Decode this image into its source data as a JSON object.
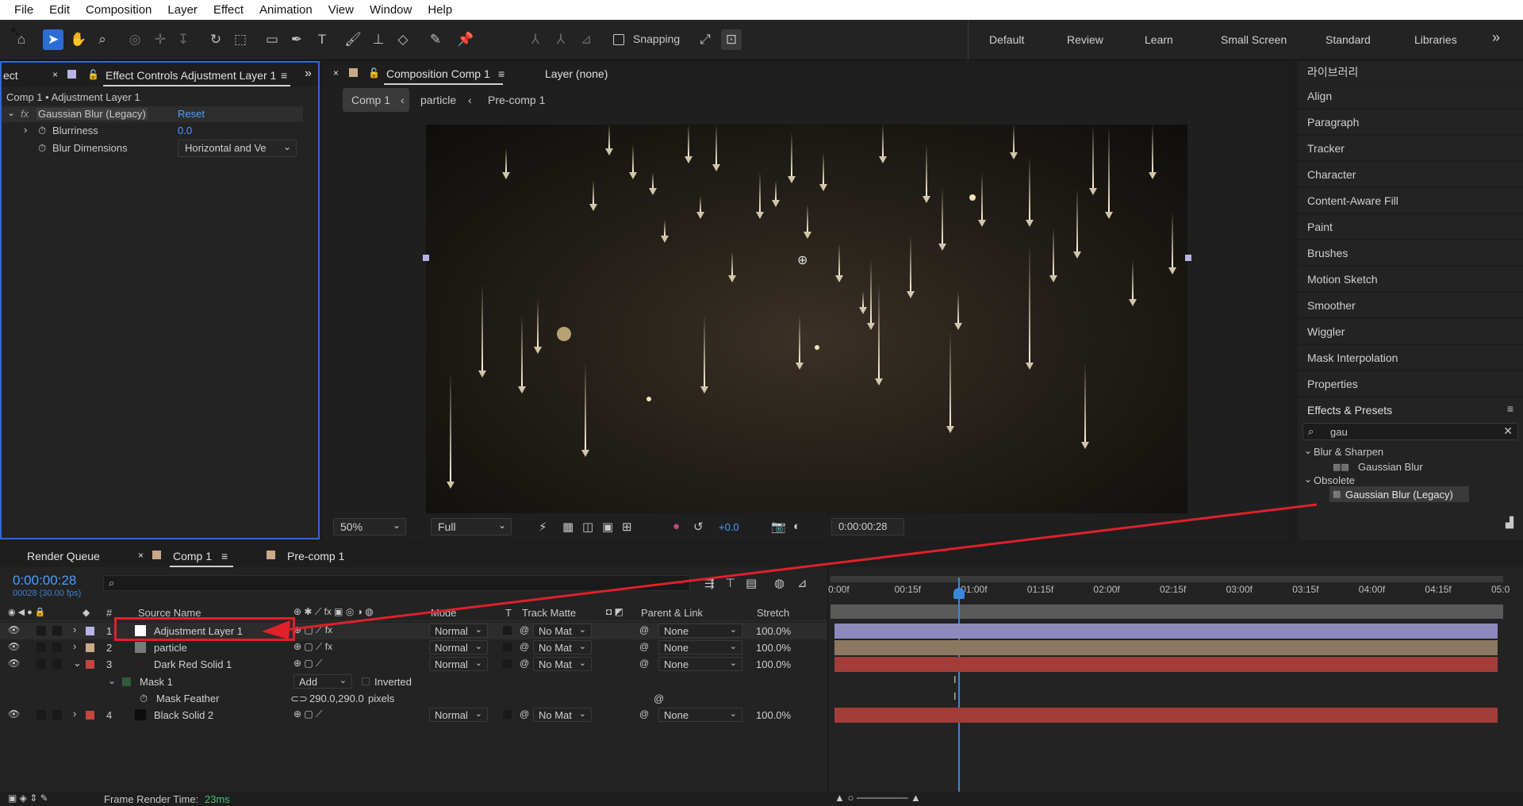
{
  "menu": [
    "File",
    "Edit",
    "Composition",
    "Layer",
    "Effect",
    "Animation",
    "View",
    "Window",
    "Help"
  ],
  "toolbar": {
    "snapping_label": "Snapping"
  },
  "workspaces": [
    "Default",
    "Review",
    "Learn",
    "Small Screen",
    "Standard",
    "Libraries"
  ],
  "effect_panel": {
    "left_tab": "ect",
    "title": "Effect Controls Adjustment Layer 1",
    "breadcrumb": "Comp 1 • Adjustment Layer 1",
    "effect_name": "Gaussian Blur (Legacy)",
    "reset_label": "Reset",
    "fx_label": "fx",
    "props": [
      {
        "name": "Blurriness",
        "value": "0.0"
      },
      {
        "name": "Blur Dimensions",
        "value": "Horizontal and Ve"
      }
    ]
  },
  "comp_panel": {
    "tab_title": "Composition Comp 1",
    "layer_tab": "Layer (none)",
    "breadcrumbs": [
      "Comp 1",
      "particle",
      "Pre-comp 1"
    ],
    "zoom": "50%",
    "resolution": "Full",
    "exposure": "+0.0",
    "timecode": "0:00:00:28"
  },
  "right_panel": {
    "library_label": "라이브러리",
    "items": [
      "Align",
      "Paragraph",
      "Tracker",
      "Character",
      "Content-Aware Fill",
      "Paint",
      "Brushes",
      "Motion Sketch",
      "Smoother",
      "Wiggler",
      "Mask Interpolation",
      "Properties"
    ],
    "effects_presets": {
      "title": "Effects & Presets",
      "search_value": "gau",
      "groups": [
        {
          "name": "Blur & Sharpen",
          "items": [
            "Gaussian Blur"
          ]
        },
        {
          "name": "Obsolete",
          "items": [
            "Gaussian Blur (Legacy)"
          ]
        }
      ]
    }
  },
  "timeline": {
    "tabs": [
      "Render Queue",
      "Comp 1",
      "Pre-comp 1"
    ],
    "timecode": "0:00:00:28",
    "frame_info": "00028 (30.00 fps)",
    "columns": {
      "num": "#",
      "source": "Source Name",
      "mode": "Mode",
      "t": "T",
      "matte": "Track Matte",
      "parent": "Parent & Link",
      "stretch": "Stretch"
    },
    "layers": [
      {
        "num": "1",
        "name": "Adjustment Layer 1",
        "mode": "Normal",
        "matte": "No Mat",
        "parent": "None",
        "stretch": "100.0%",
        "color": "#b7b3e6"
      },
      {
        "num": "2",
        "name": "particle",
        "mode": "Normal",
        "matte": "No Mat",
        "parent": "None",
        "stretch": "100.0%",
        "color": "#c9a98a"
      },
      {
        "num": "3",
        "name": "Dark Red Solid 1",
        "mode": "Normal",
        "matte": "No Mat",
        "parent": "None",
        "stretch": "100.0%",
        "color": "#c4443f"
      },
      {
        "num": "4",
        "name": "Black Solid 2",
        "mode": "Normal",
        "matte": "No Mat",
        "parent": "None",
        "stretch": "100.0%",
        "color": "#c4443f"
      }
    ],
    "mask": {
      "name": "Mask 1",
      "mode": "Add",
      "inverted_label": "Inverted",
      "feather_label": "Mask Feather",
      "feather_value": "290.0,290.0",
      "feather_unit": "pixels"
    },
    "ruler": [
      "0:00f",
      "00:15f",
      "01:00f",
      "01:15f",
      "02:00f",
      "02:15f",
      "03:00f",
      "03:15f",
      "04:00f",
      "04:15f",
      "05:0"
    ],
    "footer_label": "Frame Render Time:",
    "footer_value": "23ms"
  }
}
